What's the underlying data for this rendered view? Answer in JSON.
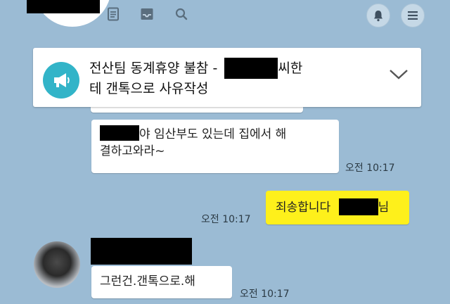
{
  "topbar": {
    "icons": [
      "document-icon",
      "tray-icon",
      "search-icon",
      "bell-icon",
      "menu-icon"
    ]
  },
  "notice": {
    "line1_before": "전산팀 동계휴양 불참 -",
    "line1_after": "씨한",
    "line2": "테 갠톡으로 사유작성"
  },
  "messages": [
    {
      "sender": "other",
      "text_line1": "야 임산부도 있는데 집에서 해",
      "text_line2": "결하고와라~",
      "time": "오전 10:17"
    },
    {
      "sender": "me",
      "text": "죄송합니다",
      "text_suffix": "님",
      "time": "오전 10:17"
    },
    {
      "sender": "other",
      "text": "그런건.갠톡으로.해",
      "time": "오전 10:17"
    }
  ],
  "colors": {
    "background": "#9bbbd4",
    "my_bubble": "#fef01b",
    "notice_icon": "#32b4c8"
  }
}
